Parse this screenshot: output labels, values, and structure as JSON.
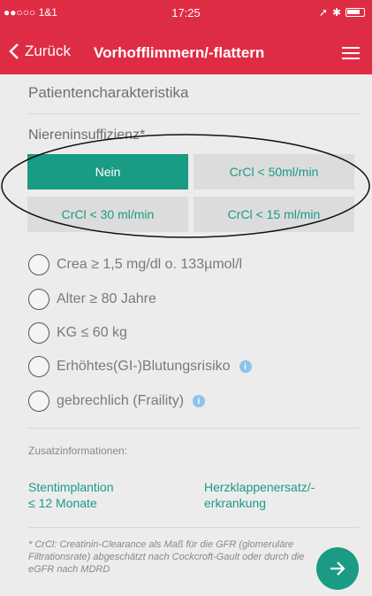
{
  "status_bar": {
    "carrier": "●●○○○ 1&1",
    "time": "17:25"
  },
  "nav": {
    "back_label": "Zurück",
    "title": "Vorhofflimmern/-flattern",
    "menu_icon": "hamburger-icon"
  },
  "section_title": "Patientencharakteristika",
  "niereninsuffizienz": {
    "label": "Niereninsuffizienz*",
    "options": [
      "Nein",
      "CrCl < 50ml/min",
      "CrCl < 30 ml/min",
      "CrCl < 15 ml/min"
    ],
    "selected": "Nein"
  },
  "checkbox_options": [
    {
      "label": "Crea ≥ 1,5 mg/dl o. 133µmol/l",
      "info": false
    },
    {
      "label": "Alter ≥ 80 Jahre",
      "info": false
    },
    {
      "label": "KG ≤ 60 kg",
      "info": false
    },
    {
      "label": "Erhöhtes(GI-)Blutungsrisiko",
      "info": true
    },
    {
      "label": "gebrechlich (Fraility)",
      "info": true
    }
  ],
  "zusatz": {
    "heading": "Zusatzinformationen:",
    "links": [
      [
        "Stentimplantion",
        "≤ 12 Monate"
      ],
      [
        "Herzklappenersatz/-",
        "erkrankung"
      ]
    ]
  },
  "footnote": "* CrCl: Creatinin-Clearance als Maß für die GFR (glomeruläre Filtrationsrate) abgeschätzt nach Cockcroft-Gault oder durch die eGFR nach MDRD",
  "colors": {
    "header": "#df2c45",
    "accent": "#1a9b84",
    "info": "#8cc3e8"
  },
  "icons": {
    "fab": "arrow-right-icon",
    "back": "chevron-left-icon"
  }
}
